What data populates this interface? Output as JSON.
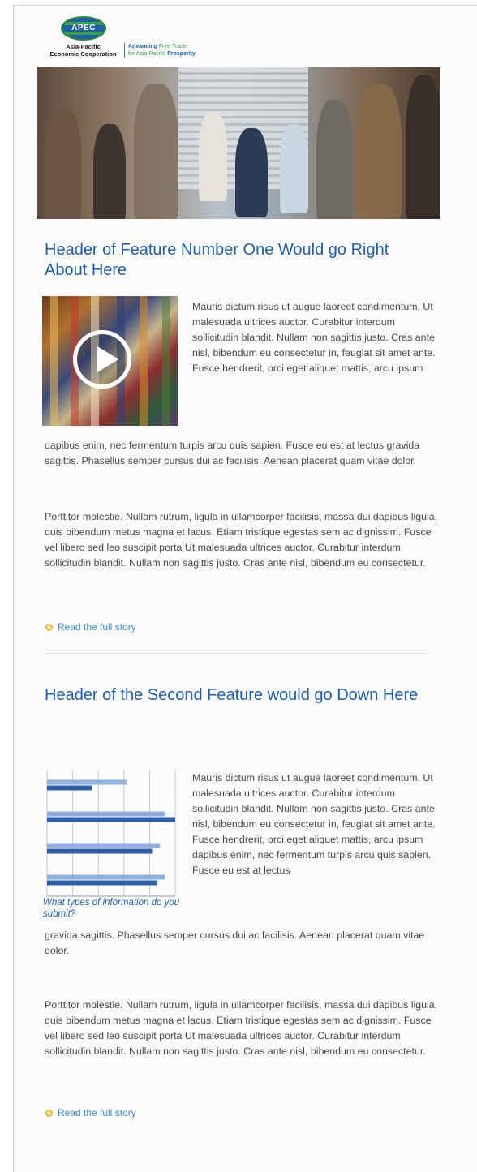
{
  "logo": {
    "emblem_text": "APEC",
    "org_name_line1": "Asia-Pacific",
    "org_name_line2": "Economic Cooperation",
    "tagline_line1_a": "Advancing ",
    "tagline_line1_b": "Free Trade",
    "tagline_line2_a": "for Asia-Pacific ",
    "tagline_line2_b": "Prosperity"
  },
  "feature1": {
    "title": "Header of Feature Number One Would go Right About Here",
    "para1": "Mauris dictum risus ut augue laoreet condimentum. Ut malesuada ultrices auctor. Curabitur interdum sollicitudin blandit. Nullam non sagittis justo. Cras ante nisl, bibendum eu consectetur in, feugiat sit amet ante. Fusce hendrerit, orci eget aliquet mattis, arcu ipsum",
    "para1_cont": "dapibus enim, nec fermentum turpis arcu quis sapien. Fusce eu est at lectus gravida sagittis. Phasellus semper cursus dui ac facilisis. Aenean placerat quam vitae dolor.",
    "para2": "Porttitor molestie. Nullam rutrum, ligula in ullamcorper facilisis, massa dui dapibus ligula, quis bibendum metus magna et lacus. Etiam tristique egestas sem ac dignissim. Fusce vel libero sed leo suscipit porta Ut malesuada ultrices auctor. Curabitur interdum sollicitudin blandit. Nullam non sagittis justo. Cras ante nisl, bibendum eu consectetur.",
    "read_more": "Read the full story"
  },
  "feature2": {
    "title": "Header of the Second Feature would go Down Here",
    "chart_caption": "What types of information do you submit?",
    "para1": "Mauris dictum risus ut augue laoreet condimentum. Ut malesuada ultrices auctor. Curabitur interdum sollicitudin blandit. Nullam non sagittis justo. Cras ante nisl, bibendum eu consectetur in, feugiat sit amet ante. Fusce hendrerit, orci eget aliquet mattis, arcu ipsum dapibus enim, nec fermentum turpis arcu quis sapien. Fusce eu est at lectus",
    "para1_cont": "gravida sagittis. Phasellus semper cursus dui ac facilisis. Aenean placerat quam vitae dolor.",
    "para2": "Porttitor molestie. Nullam rutrum, ligula in ullamcorper facilisis, massa dui dapibus ligula, quis bibendum metus magna et lacus. Etiam tristique egestas sem ac dignissim. Fusce vel libero sed leo suscipit porta Ut malesuada ultrices auctor. Curabitur interdum sollicitudin blandit. Nullam non sagittis justo. Cras ante nisl, bibendum eu consectetur.",
    "read_more": "Read the full story"
  },
  "chart_data": {
    "type": "bar",
    "orientation": "horizontal",
    "categories": [
      "",
      "",
      "",
      ""
    ],
    "series": [
      {
        "values": [
          62,
          92,
          88,
          92
        ],
        "color": "#8fb0dc"
      },
      {
        "values": [
          35,
          100,
          82,
          86
        ],
        "color": "#2f5fa8"
      }
    ],
    "title": "",
    "xlabel": "",
    "ylabel": "",
    "xlim": [
      0,
      100
    ],
    "grid": true
  },
  "colors": {
    "heading_blue": "#1f5ea8",
    "link_blue": "#3a8fd0",
    "bullet_yellow": "#f2b531",
    "body_text": "#4a4a4a"
  },
  "icons": {
    "read_more": "circle-bullet-icon",
    "video": "play-icon"
  }
}
